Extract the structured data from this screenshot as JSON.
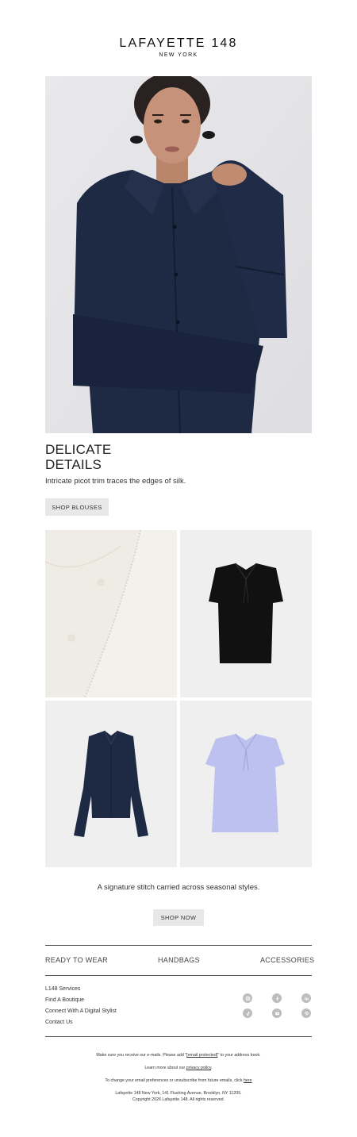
{
  "brand": {
    "name": "LAFAYETTE 148",
    "sub": "NEW YORK"
  },
  "hero": {
    "headline_line1": "DELICATE",
    "headline_line2": "DETAILS",
    "subcopy": "Intricate picot trim traces the edges of silk.",
    "button": "SHOP BLOUSES"
  },
  "grid": {
    "tagline": "A signature stitch carried across seasonal styles.",
    "button": "SHOP NOW"
  },
  "nav": {
    "items": [
      "READY TO WEAR",
      "HANDBAGS",
      "ACCESSORIES"
    ]
  },
  "footer": {
    "links": [
      "L148 Services",
      "Find A Boutique",
      "Connect With A Digital Stylist",
      "Contact Us"
    ],
    "social": [
      "instagram-icon",
      "facebook-icon",
      "linkedin-icon",
      "tiktok-icon",
      "youtube-icon",
      "pinterest-icon"
    ],
    "legal": {
      "line1_pre": "Make sure you receive our e-mails. Please add \"",
      "line1_link": "[email protected]",
      "line1_post": "\" to your address book.",
      "line2_pre": "Learn more about our ",
      "line2_link": "privacy policy",
      "line2_post": ".",
      "line3_pre": "To change your email preferences or unsubscribe from future emails, click ",
      "line3_link": "here",
      "address": "Lafayette 148 New York, 141 Flushing Avenue, Brooklyn, NY 11205.",
      "copyright": "Copyright 2026 Lafayette 148. All rights reserved."
    }
  },
  "colors": {
    "navy": "#1e2a44",
    "black": "#111111",
    "lavender": "#bcc1ef",
    "ivory": "#f6f4ef",
    "button_bg": "#e8e8e8"
  }
}
